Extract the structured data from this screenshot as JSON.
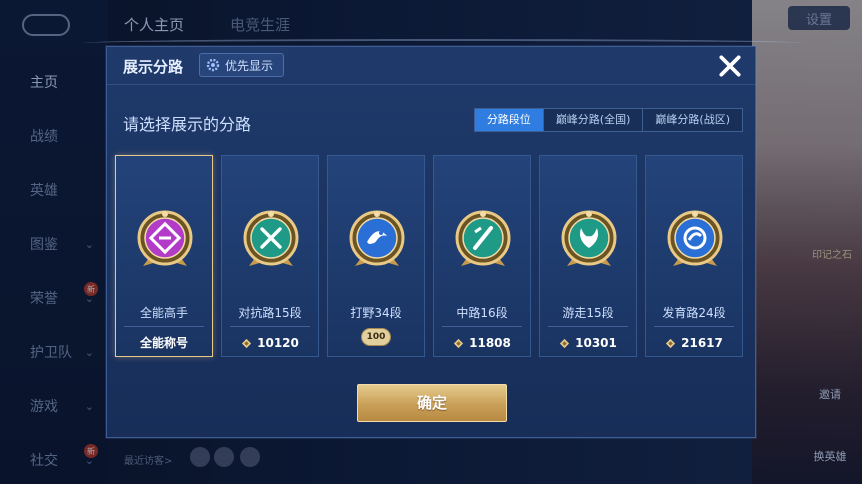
{
  "background": {
    "top_tabs": [
      "个人主页",
      "电竞生涯"
    ],
    "settings_label": "设置",
    "nav_items": [
      {
        "label": "主页",
        "chevron": false,
        "active": true,
        "new": false
      },
      {
        "label": "战绩",
        "chevron": false,
        "active": false,
        "new": false
      },
      {
        "label": "英雄",
        "chevron": false,
        "active": false,
        "new": false
      },
      {
        "label": "图鉴",
        "chevron": true,
        "active": false,
        "new": false
      },
      {
        "label": "荣誉",
        "chevron": true,
        "active": false,
        "new": true
      },
      {
        "label": "护卫队",
        "chevron": true,
        "active": false,
        "new": false
      },
      {
        "label": "游戏",
        "chevron": true,
        "active": false,
        "new": false
      },
      {
        "label": "社交",
        "chevron": true,
        "active": false,
        "new": true
      }
    ],
    "new_badge": "新",
    "recent_visitors_label": "最近访客>",
    "side_buttons": [
      "邀请",
      "换英雄"
    ],
    "side_tag": "印记之石"
  },
  "modal": {
    "title": "展示分路",
    "priority_button": "优先显示",
    "subtitle": "请选择展示的分路",
    "filter_tabs": [
      {
        "label": "分路段位",
        "active": true
      },
      {
        "label": "巅峰分路(全国)",
        "active": false
      },
      {
        "label": "巅峰分路(战区)",
        "active": false
      }
    ],
    "cards": [
      {
        "name": "全能高手",
        "tag": "全能称号",
        "score": null,
        "badge": null,
        "selected": true,
        "emblem": "versatile-emblem-icon",
        "color": "#b23cc8"
      },
      {
        "name": "对抗路15段",
        "tag": null,
        "score": "10120",
        "badge": null,
        "selected": false,
        "emblem": "clash-lane-emblem-icon",
        "color": "#1f9a86"
      },
      {
        "name": "打野34段",
        "tag": null,
        "score": null,
        "badge": "100",
        "selected": false,
        "emblem": "jungle-emblem-icon",
        "color": "#2a6fd6"
      },
      {
        "name": "中路16段",
        "tag": null,
        "score": "11808",
        "badge": null,
        "selected": false,
        "emblem": "mid-lane-emblem-icon",
        "color": "#1f9a86"
      },
      {
        "name": "游走15段",
        "tag": null,
        "score": "10301",
        "badge": null,
        "selected": false,
        "emblem": "roam-emblem-icon",
        "color": "#1f9a86"
      },
      {
        "name": "发育路24段",
        "tag": null,
        "score": "21617",
        "badge": null,
        "selected": false,
        "emblem": "farm-lane-emblem-icon",
        "color": "#2a6fd6"
      }
    ],
    "confirm_label": "确定",
    "close_icon": "close-icon",
    "accent_gold": "#e6cb8e",
    "accent_blue": "#2f7de0"
  }
}
